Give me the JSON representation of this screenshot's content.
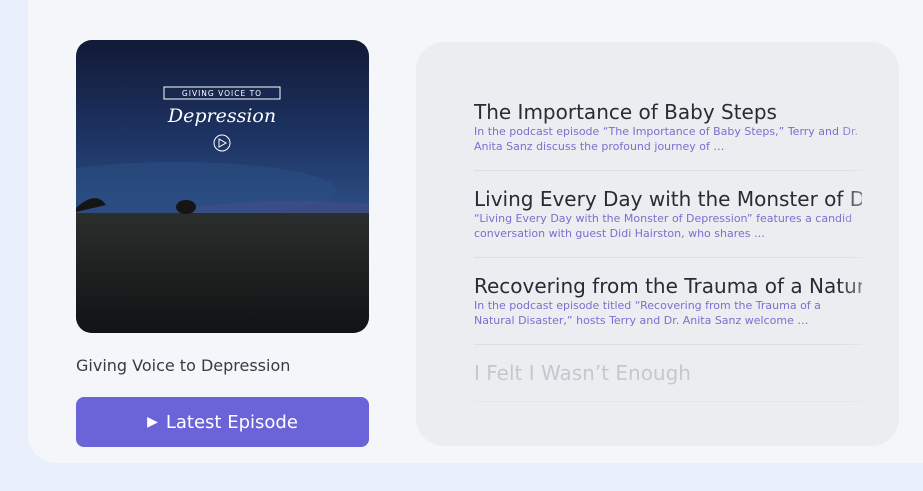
{
  "podcast": {
    "cover_line1": "GIVING VOICE TO",
    "cover_line2": "Depression",
    "show_title": "Giving Voice to Depression",
    "latest_label": "Latest Episode"
  },
  "episodes": [
    {
      "title": "The Importance of Baby Steps",
      "description": "In the podcast episode “The Importance of Baby Steps,” Terry and Dr. Anita Sanz discuss the profound journey of …"
    },
    {
      "title": "Living Every Day with the Monster of Depression",
      "description": "“Living Every Day with the Monster of Depression” features a candid conversation with guest Didi Hairston, who shares …"
    },
    {
      "title": "Recovering from the Trauma of a Natural Disaster",
      "description": "In the podcast episode titled “Recovering from the Trauma of a Natural Disaster,” hosts Terry and Dr. Anita Sanz welcome …"
    },
    {
      "title": "I Felt I Wasn’t Enough",
      "description": ""
    }
  ],
  "colors": {
    "accent": "#6b63d8",
    "description_text": "#7a6fd0"
  },
  "icons": {
    "play_button": "play-triangle-icon",
    "cover_play": "circle-play-icon"
  }
}
